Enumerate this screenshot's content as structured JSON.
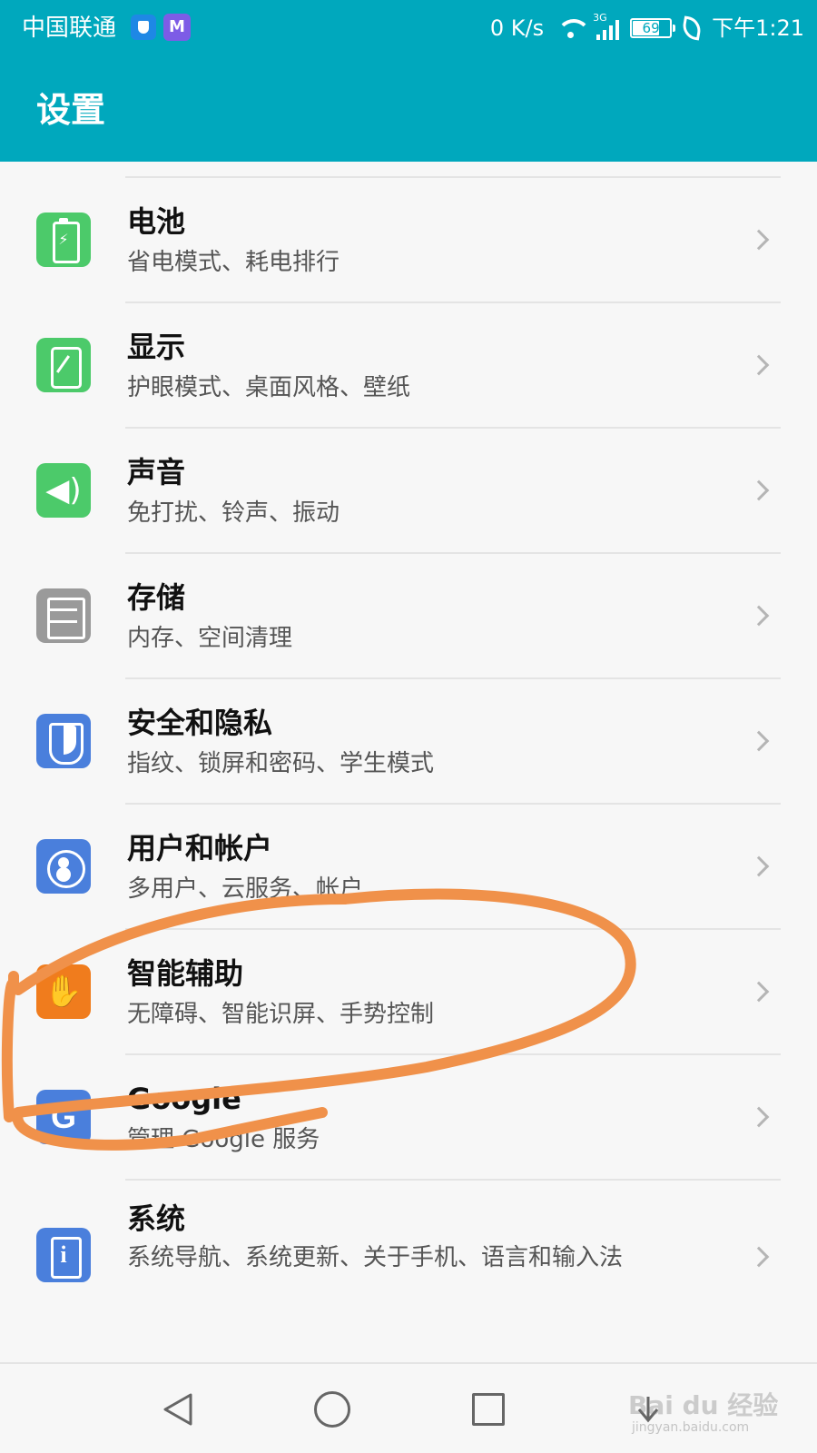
{
  "status_bar": {
    "carrier": "中国联通",
    "net_speed": "0 K/s",
    "network_type": "3G",
    "battery_level": "69",
    "time": "下午1:21",
    "icons": [
      "shield-icon",
      "app-m-icon",
      "wifi-icon",
      "signal-icon",
      "battery-icon",
      "leaf-icon"
    ]
  },
  "app_bar": {
    "title": "设置"
  },
  "settings": {
    "items": [
      {
        "title": "电池",
        "subtitle": "省电模式、耗电排行",
        "icon": "battery-icon",
        "color": "#4cca6a"
      },
      {
        "title": "显示",
        "subtitle": "护眼模式、桌面风格、壁纸",
        "icon": "display-icon",
        "color": "#4cca6a"
      },
      {
        "title": "声音",
        "subtitle": "免打扰、铃声、振动",
        "icon": "speaker-icon",
        "color": "#4cca6a"
      },
      {
        "title": "存储",
        "subtitle": "内存、空间清理",
        "icon": "storage-icon",
        "color": "#9a9a9a"
      },
      {
        "title": "安全和隐私",
        "subtitle": "指纹、锁屏和密码、学生模式",
        "icon": "shield-icon",
        "color": "#4a7fdc"
      },
      {
        "title": "用户和帐户",
        "subtitle": "多用户、云服务、帐户",
        "icon": "user-icon",
        "color": "#4a7fdc"
      },
      {
        "title": "智能辅助",
        "subtitle": "无障碍、智能识屏、手势控制",
        "icon": "hand-icon",
        "color": "#f07c1d"
      },
      {
        "title": "Google",
        "subtitle": "管理 Google 服务",
        "icon": "google-icon",
        "color": "#4a7fdc"
      },
      {
        "title": "系统",
        "subtitle": "系统导航、系统更新、关于手机、语言和输入法",
        "icon": "info-icon",
        "color": "#4a7fdc"
      }
    ]
  },
  "nav_bar": {
    "buttons": [
      "back-icon",
      "home-icon",
      "recents-icon",
      "down-icon"
    ]
  },
  "watermark": {
    "brand": "Bai du 经验",
    "url": "jingyan.baidu.com"
  },
  "annotation": {
    "color": "#f0914a"
  }
}
